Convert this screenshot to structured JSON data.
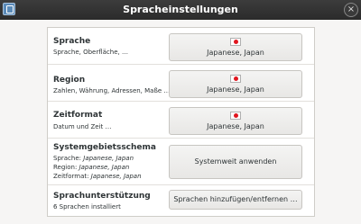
{
  "window": {
    "title": "Spracheinstellungen",
    "close_symbol": "×"
  },
  "rows": {
    "language": {
      "title": "Sprache",
      "subtitle": "Sprache, Oberfläche, …",
      "button_label": "Japanese, Japan"
    },
    "region": {
      "title": "Region",
      "subtitle": "Zahlen, Währung, Adressen, Maße …",
      "button_label": "Japanese, Japan"
    },
    "time_format": {
      "title": "Zeitformat",
      "subtitle": "Datum und Zeit …",
      "button_label": "Japanese, Japan"
    },
    "system_locale": {
      "title": "Systemgebietsschema",
      "lines": [
        {
          "label": "Sprache:",
          "value": "Japanese, Japan"
        },
        {
          "label": "Region:",
          "value": "Japanese, Japan"
        },
        {
          "label": "Zeitformat:",
          "value": "Japanese, Japan"
        }
      ],
      "button_label": "Systemweit anwenden"
    },
    "language_support": {
      "title": "Sprachunterstützung",
      "subtitle": "6 Sprachen installiert",
      "button_label": "Sprachen hinzufügen/entfernen …"
    }
  },
  "colors": {
    "titlebar": "#2b2b2b",
    "flag_red": "#e0161f",
    "background": "#f6f5f4",
    "panel": "#ffffff"
  },
  "icons": {
    "app": "language-settings-icon",
    "flag": "flag-japan-icon"
  }
}
